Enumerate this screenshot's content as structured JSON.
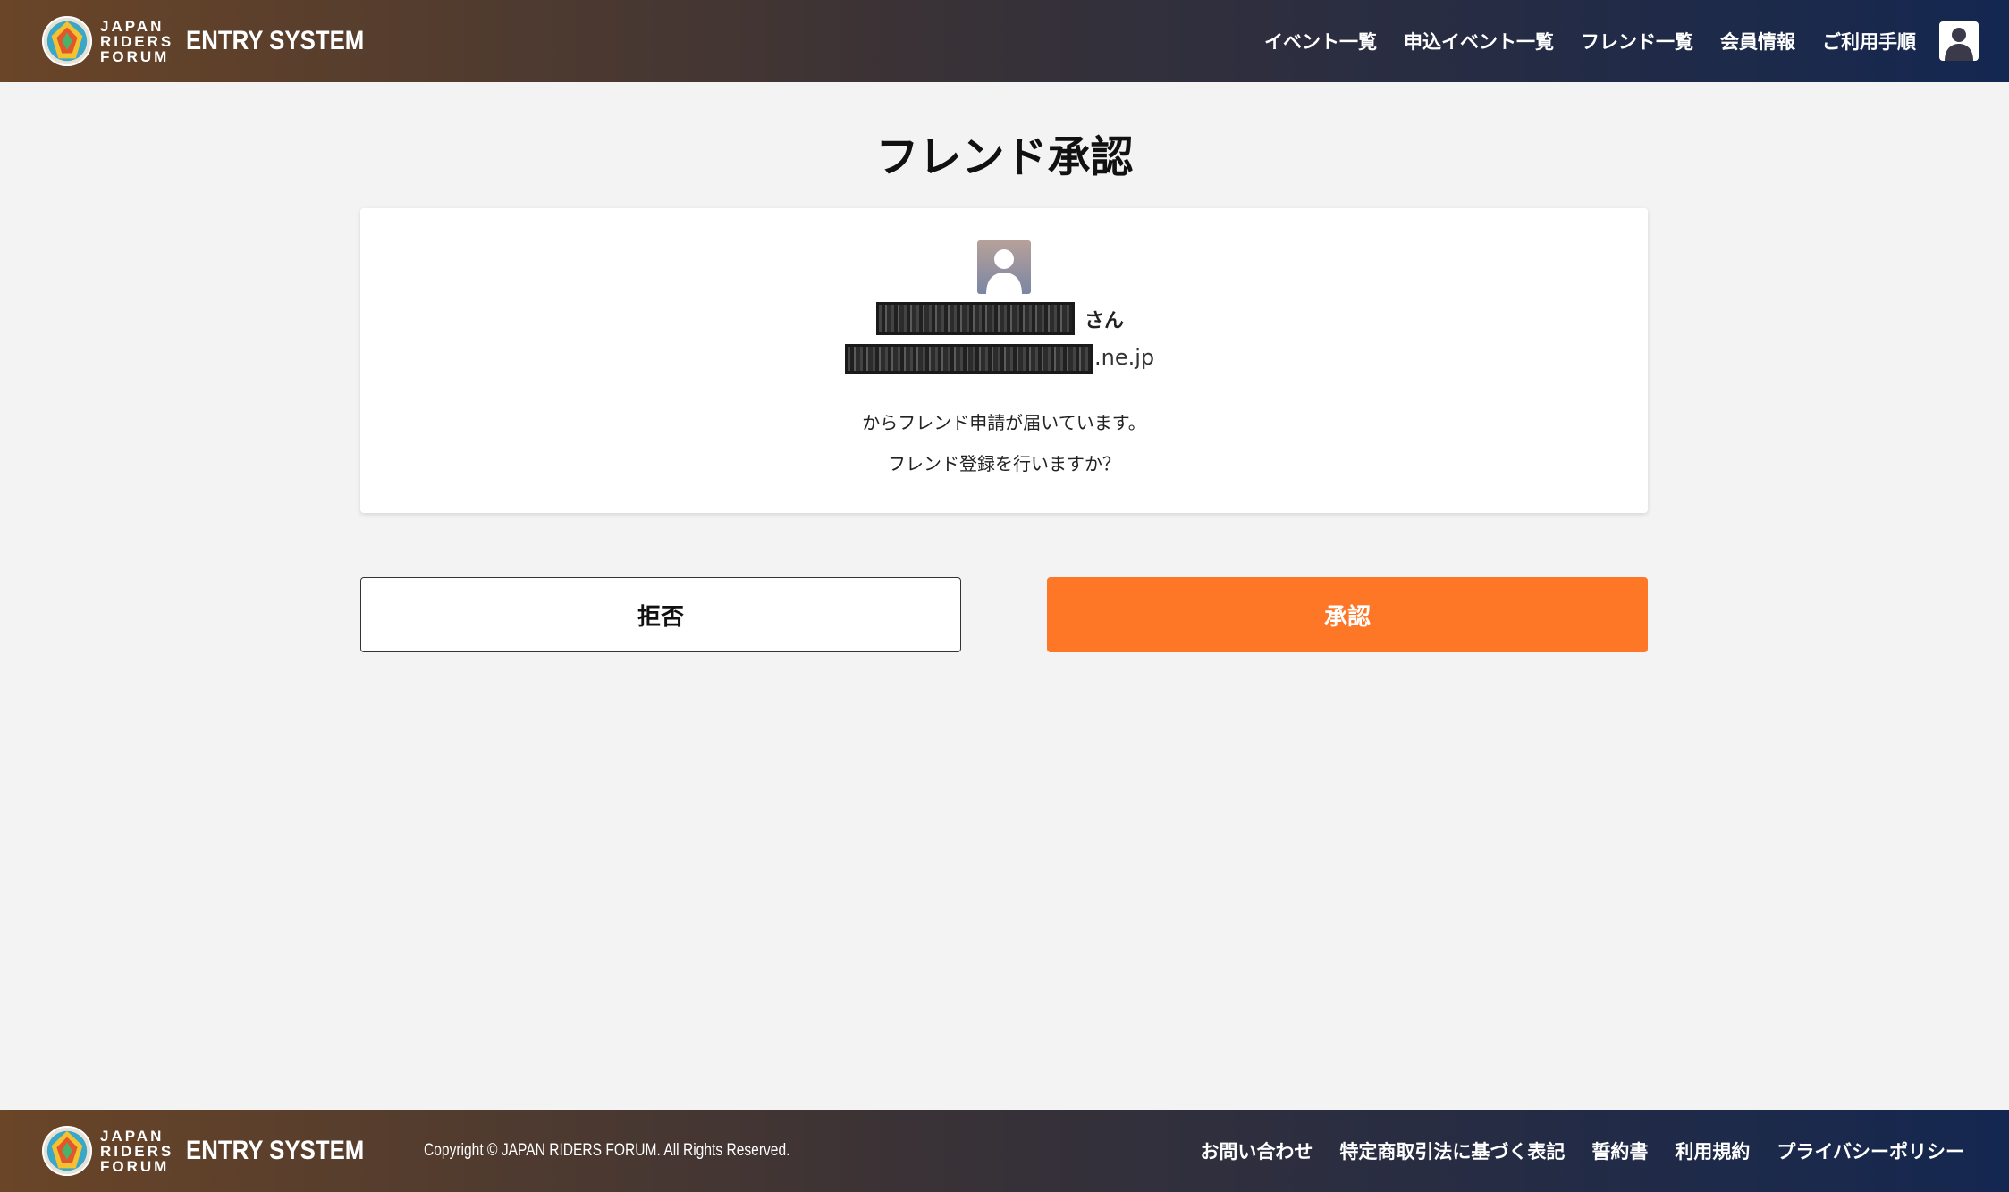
{
  "header": {
    "logo_words": [
      "JAPAN",
      "RIDERS",
      "FORUM"
    ],
    "logo_system": "ENTRY SYSTEM",
    "nav": [
      {
        "name": "nav-event-list",
        "label": "イベント一覧"
      },
      {
        "name": "nav-applied-events",
        "label": "申込イベント一覧"
      },
      {
        "name": "nav-friend-list",
        "label": "フレンド一覧"
      },
      {
        "name": "nav-member-info",
        "label": "会員情報"
      },
      {
        "name": "nav-usage-guide",
        "label": "ご利用手順"
      }
    ],
    "user_icon": "user-icon"
  },
  "main": {
    "title": "フレンド承認",
    "card": {
      "honorific": "さん",
      "email_suffix": ".ne.jp",
      "message_line1": "からフレンド申請が届いています。",
      "message_line2": "フレンド登録を行いますか？"
    },
    "reject_label": "拒否",
    "approve_label": "承認"
  },
  "footer": {
    "logo_words": [
      "JAPAN",
      "RIDERS",
      "FORUM"
    ],
    "logo_system": "ENTRY SYSTEM",
    "copyright": "Copyright © JAPAN RIDERS FORUM. All Rights Reserved.",
    "links": [
      {
        "name": "footer-contact",
        "label": "お問い合わせ"
      },
      {
        "name": "footer-commerce-law",
        "label": "特定商取引法に基づく表記"
      },
      {
        "name": "footer-pledge",
        "label": "誓約書"
      },
      {
        "name": "footer-terms",
        "label": "利用規約"
      },
      {
        "name": "footer-privacy",
        "label": "プライバシーポリシー"
      }
    ]
  },
  "colors": {
    "accent": "#fd7726",
    "header_left": "#6a4527",
    "header_right": "#142750",
    "background": "#f3f3f3"
  }
}
